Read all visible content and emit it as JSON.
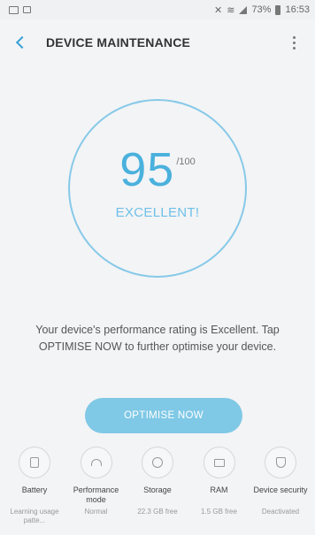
{
  "status_bar": {
    "battery": "73%",
    "time": "16:53"
  },
  "header": {
    "title": "DEVICE MAINTENANCE"
  },
  "score": {
    "value": "95",
    "max": "/100",
    "rating": "EXCELLENT!"
  },
  "description": "Your device's performance rating is Excellent. Tap OPTIMISE NOW to further optimise your device.",
  "cta_label": "OPTIMISE NOW",
  "cards": [
    {
      "name": "Battery",
      "status": "Learning usage patte..."
    },
    {
      "name": "Performance mode",
      "status": "Normal"
    },
    {
      "name": "Storage",
      "status": "22.3 GB free"
    },
    {
      "name": "RAM",
      "status": "1.5 GB free"
    },
    {
      "name": "Device security",
      "status": "Deactivated"
    }
  ],
  "colors": {
    "accent": "#4ab1dd",
    "ring": "#86c9e8",
    "button": "#7fc8e6"
  }
}
